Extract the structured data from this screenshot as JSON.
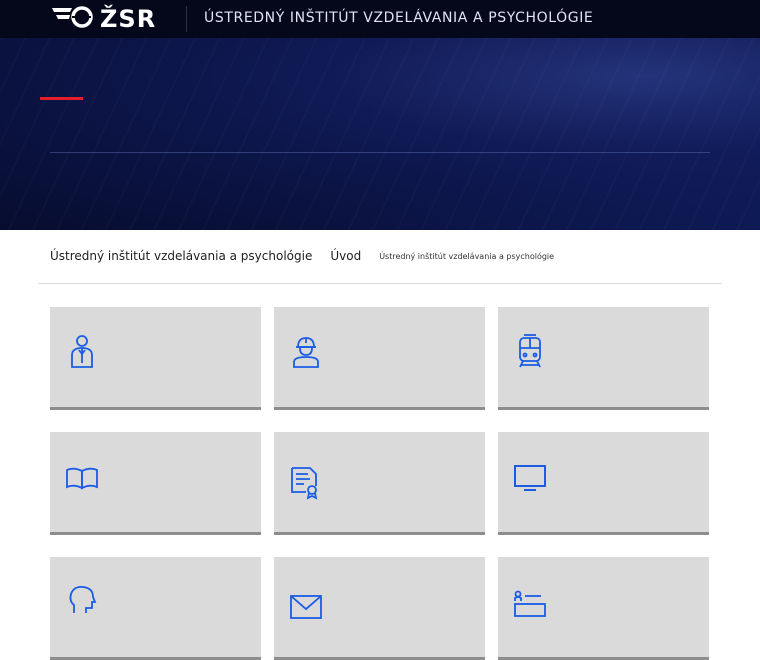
{
  "header": {
    "logo_text": "ŽSR",
    "logo_icon": "zsr-wings-logo",
    "site_title": "ÚSTREDNÝ INŠTITÚT VZDELÁVANIA A PSYCHOLÓGIE"
  },
  "breadcrumb": {
    "section": "Ústredný inštitút vzdelávania a psychológie",
    "home": "Úvod",
    "current": "Ústredný inštitút vzdelávania a psychológie"
  },
  "colors": {
    "accent_red": "#e3202a",
    "icon_blue": "#1a5ce6",
    "tile_bg": "#dadada",
    "header_bg": "#05071a"
  },
  "tiles": [
    {
      "icon": "employee-person-icon"
    },
    {
      "icon": "worker-helmet-icon"
    },
    {
      "icon": "train-icon"
    },
    {
      "icon": "open-book-icon"
    },
    {
      "icon": "certificate-document-icon"
    },
    {
      "icon": "monitor-icon"
    },
    {
      "icon": "head-profile-icon"
    },
    {
      "icon": "envelope-icon"
    },
    {
      "icon": "id-card-icon"
    }
  ]
}
